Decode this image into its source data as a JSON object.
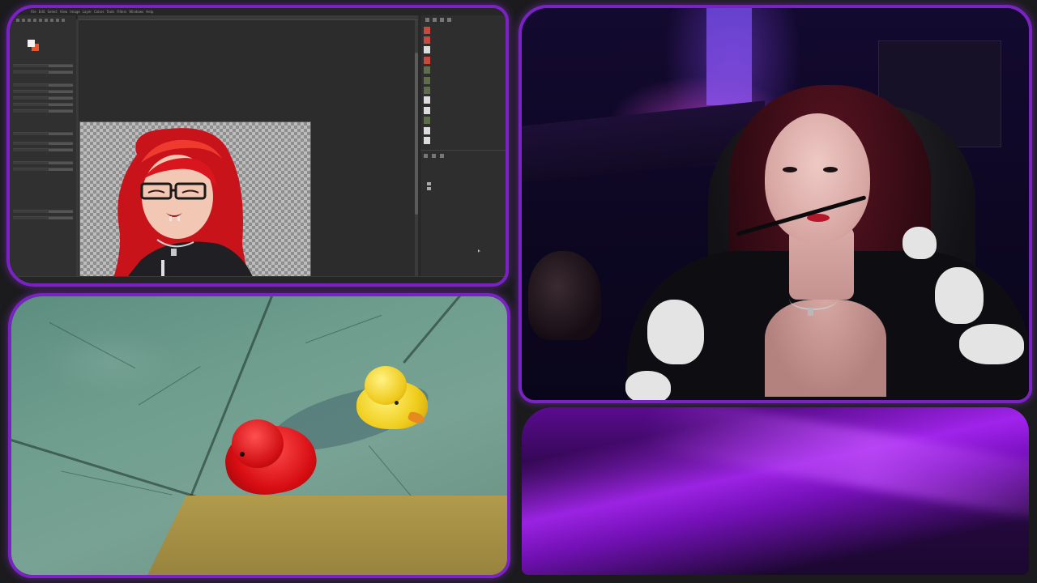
{
  "colors": {
    "frame_border": "#7b22c4",
    "page_background": "#1b1b1d",
    "gimp_background": "#2b2b2b",
    "accent_glow": "#a02af0"
  },
  "gimp": {
    "menu": [
      "File",
      "Edit",
      "Select",
      "View",
      "Image",
      "Layer",
      "Colors",
      "Tools",
      "Filters",
      "Windows",
      "Help"
    ],
    "documents": [
      {
        "thumb": "ph"
      },
      {
        "thumb": "ph"
      },
      {
        "thumb": "wh"
      },
      {
        "thumb": "ph"
      },
      {
        "thumb": "sc"
      },
      {
        "thumb": "sc"
      },
      {
        "thumb": "sc"
      },
      {
        "thumb": "wh"
      },
      {
        "thumb": "wh"
      },
      {
        "thumb": "sc"
      },
      {
        "thumb": "wh"
      },
      {
        "thumb": "wh"
      }
    ]
  }
}
